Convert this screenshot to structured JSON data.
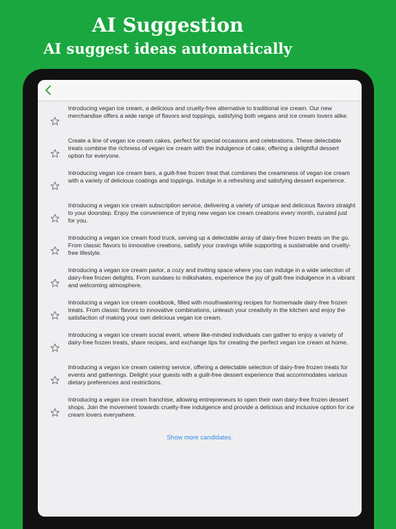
{
  "promo": {
    "title": "AI Suggestion",
    "subtitle": "AI suggest ideas automatically"
  },
  "navbar": {
    "back_icon": "chevron-left-icon"
  },
  "colors": {
    "background": "#1aa73f",
    "accent": "#3a8ae0",
    "back_chevron": "#2e9b3b"
  },
  "candidates": [
    {
      "text": "Introducing vegan ice cream, a delicious and cruelty-free alternative to traditional ice cream. Our new merchandise offers a wide range of flavors and toppings, satisfying both vegans and ice cream lovers alike."
    },
    {
      "text": "Create a line of vegan ice cream cakes, perfect for special occasions and celebrations. These delectable treats combine the richness of vegan ice cream with the indulgence of cake, offering a delightful dessert option for everyone."
    },
    {
      "text": "Introducing vegan ice cream bars, a guilt-free frozen treat that combines the creaminess of vegan ice cream with a variety of delicious coatings and toppings. Indulge in a refreshing and satisfying dessert experience."
    },
    {
      "text": "Introducing a vegan ice cream subscription service, delivering a variety of unique and delicious flavors straight to your doorstep. Enjoy the convenience of trying new vegan ice cream creations every month, curated just for you."
    },
    {
      "text": "Introducing a vegan ice cream food truck, serving up a delectable array of dairy-free frozen treats on the go. From classic flavors to innovative creations, satisfy your cravings while supporting a sustainable and cruelty-free lifestyle."
    },
    {
      "text": "Introducing a vegan ice cream parlor, a cozy and inviting space where you can indulge in a wide selection of dairy-free frozen delights. From sundaes to milkshakes, experience the joy of guilt-free indulgence in a vibrant and welcoming atmosphere."
    },
    {
      "text": "Introducing a vegan ice cream cookbook, filled with mouthwatering recipes for homemade dairy-free frozen treats. From classic flavors to innovative combinations, unleash your creativity in the kitchen and enjoy the satisfaction of making your own delicious vegan ice cream."
    },
    {
      "text": "Introducing a vegan ice cream social event, where like-minded individuals can gather to enjoy a variety of dairy-free frozen treats, share recipes, and exchange tips for creating the perfect vegan ice cream at home."
    },
    {
      "text": "Introducing a vegan ice cream catering service, offering a delectable selection of dairy-free frozen treats for events and gatherings. Delight your guests with a guilt-free dessert experience that accommodates various dietary preferences and restrictions."
    },
    {
      "text": "Introducing a vegan ice cream franchise, allowing entrepreneurs to open their own dairy-free frozen dessert shops. Join the movement towards cruelty-free indulgence and provide a delicious and inclusive option for ice cream lovers everywhere."
    }
  ],
  "star_icon": "star-outline-icon",
  "show_more_label": "Show more candidates."
}
